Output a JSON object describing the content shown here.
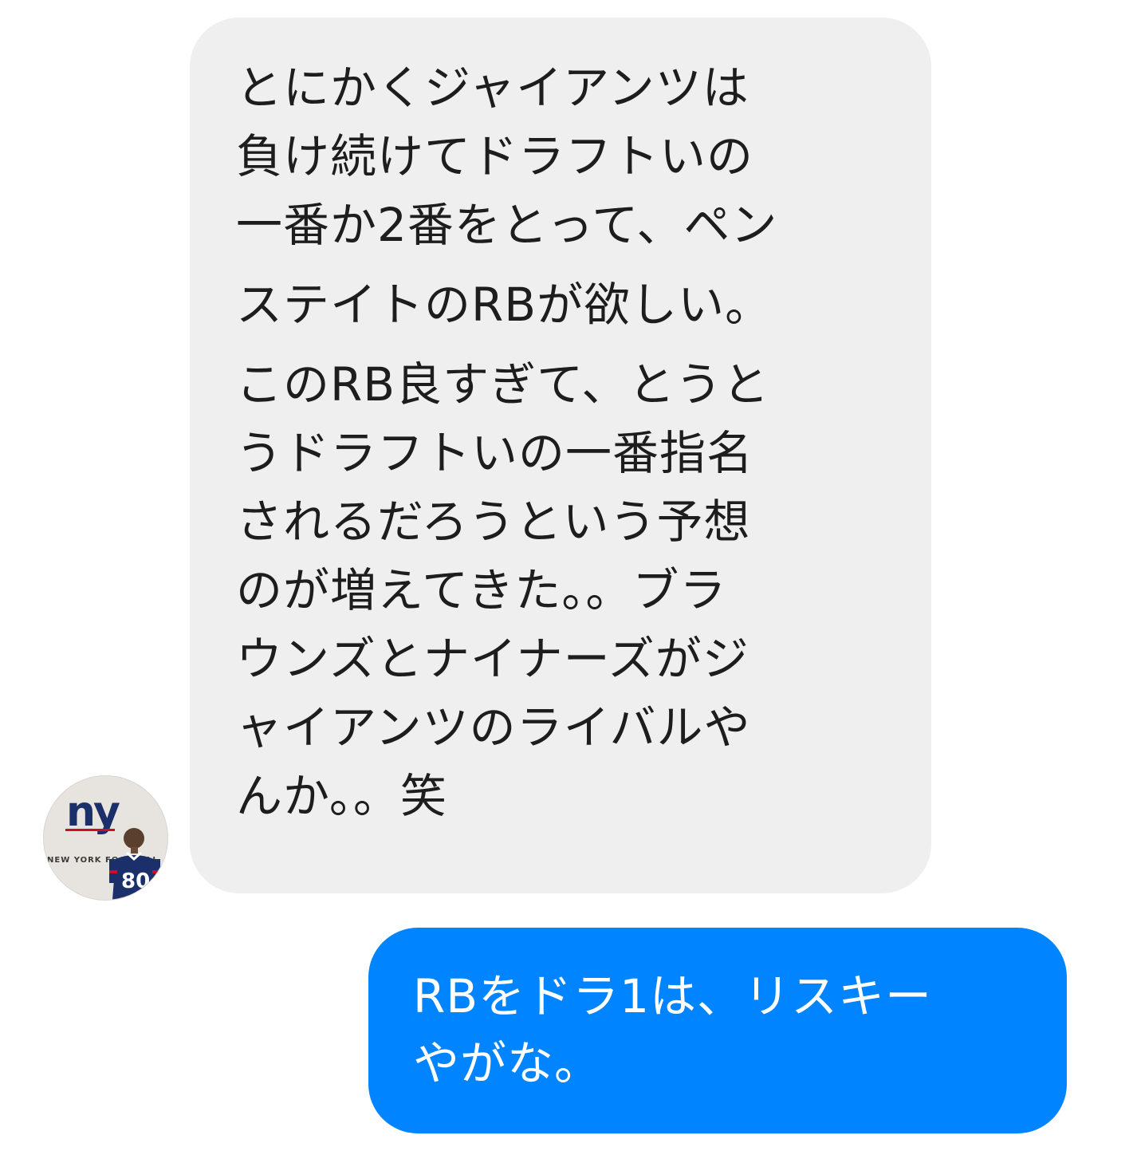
{
  "conversation": {
    "incoming": {
      "sender_avatar": {
        "logo_text": "ny",
        "jersey_number": "80",
        "wall_text": "NEW YORK FOOTBALL"
      },
      "lines": [
        "とにかくジャイアンツは",
        "負け続けてドラフトいの",
        "一番か2番をとって、ペン",
        "ステイトのRBが欲しい。",
        "このRB良すぎて、とうと",
        "うドラフトいの一番指名",
        "されるだろうという予想",
        "のが増えてきた。。ブラ",
        "ウンズとナイナーズがジ",
        "ャイアンツのライバルや",
        "んか。。笑"
      ]
    },
    "outgoing": {
      "lines": [
        "RBをドラ1は、リスキー",
        "やがな。"
      ]
    }
  },
  "colors": {
    "incoming_bubble": "#efefef",
    "outgoing_bubble": "#0084ff",
    "incoming_text": "#1d1d1d",
    "outgoing_text": "#ffffff",
    "logo_blue": "#1b2f6b",
    "logo_red": "#c8102e"
  }
}
